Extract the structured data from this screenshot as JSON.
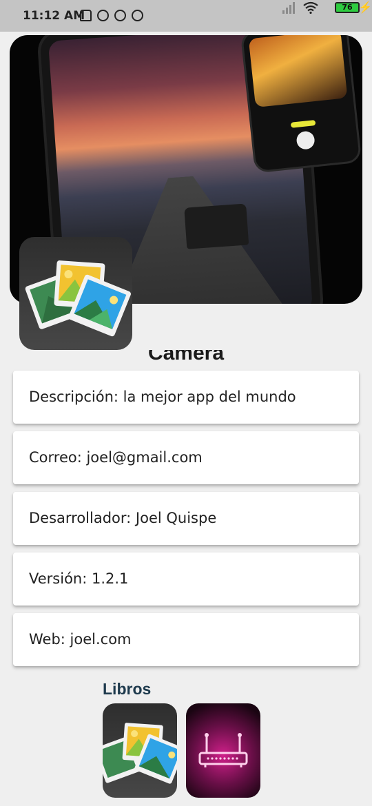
{
  "status_bar": {
    "time": "11:12 AM",
    "battery": "76",
    "icons": [
      "mute-bell-icon",
      "alarm-icon",
      "dnd-icon",
      "dnd-icon",
      "signal-icon",
      "wifi-icon",
      "battery-icon",
      "charging-icon"
    ]
  },
  "app": {
    "name": "Camera",
    "hero_image": "camera-app-promo-image",
    "icon": "photos-stack-icon"
  },
  "details": [
    {
      "label": "Descripción: la mejor app del mundo"
    },
    {
      "label": "Correo: joel@gmail.com"
    },
    {
      "label": "Desarrollador: Joel Quispe"
    },
    {
      "label": "Versión: 1.2.1"
    },
    {
      "label": "Web: joel.com"
    }
  ],
  "books": {
    "title": "Libros",
    "items": [
      {
        "icon": "photos-stack-icon",
        "color": "#3a3a3a"
      },
      {
        "icon": "neon-router-icon",
        "color": "#c81e82"
      }
    ]
  }
}
